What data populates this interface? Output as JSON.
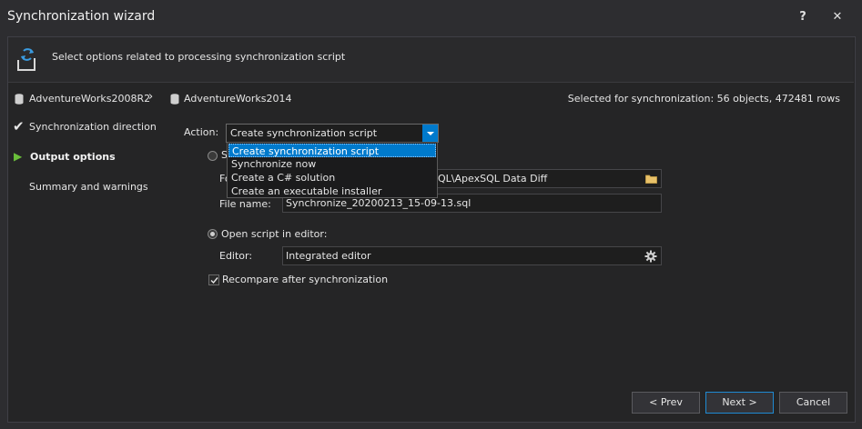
{
  "window": {
    "title": "Synchronization wizard",
    "help_label": "?",
    "close_label": "✕"
  },
  "header": {
    "text": "Select options related to processing synchronization script"
  },
  "breadcrumb": {
    "source_db": "AdventureWorks2008R2",
    "separator": "›",
    "target_db": "AdventureWorks2014",
    "selected_summary": "Selected for synchronization: 56 objects, 472481 rows"
  },
  "steps": [
    {
      "label": "Synchronization direction",
      "marker": "✔"
    },
    {
      "label": "Output options",
      "marker": "▶"
    },
    {
      "label": "Summary and warnings",
      "marker": ""
    }
  ],
  "action": {
    "label": "Action:",
    "selected": "Create synchronization script",
    "options": [
      "Create synchronization script",
      "Synchronize now",
      "Create a C# solution",
      "Create an executable installer"
    ]
  },
  "save_script": {
    "radio_label_partial": "S",
    "folder_label_partial": "Fo",
    "folder_value_partial": "QL\\ApexSQL Data Diff",
    "file_name_label": "File name:",
    "file_name_value": "Synchronize_20200213_15-09-13.sql"
  },
  "open_editor": {
    "radio_label": "Open script in editor:",
    "editor_label": "Editor:",
    "editor_value": "Integrated editor"
  },
  "recompare": {
    "label": "Recompare after synchronization",
    "checked": true
  },
  "buttons": {
    "prev": "< Prev",
    "next": "Next >",
    "cancel": "Cancel"
  },
  "colors": {
    "accent": "#007acc",
    "step_active": "#6abf3a",
    "background": "#252526"
  }
}
